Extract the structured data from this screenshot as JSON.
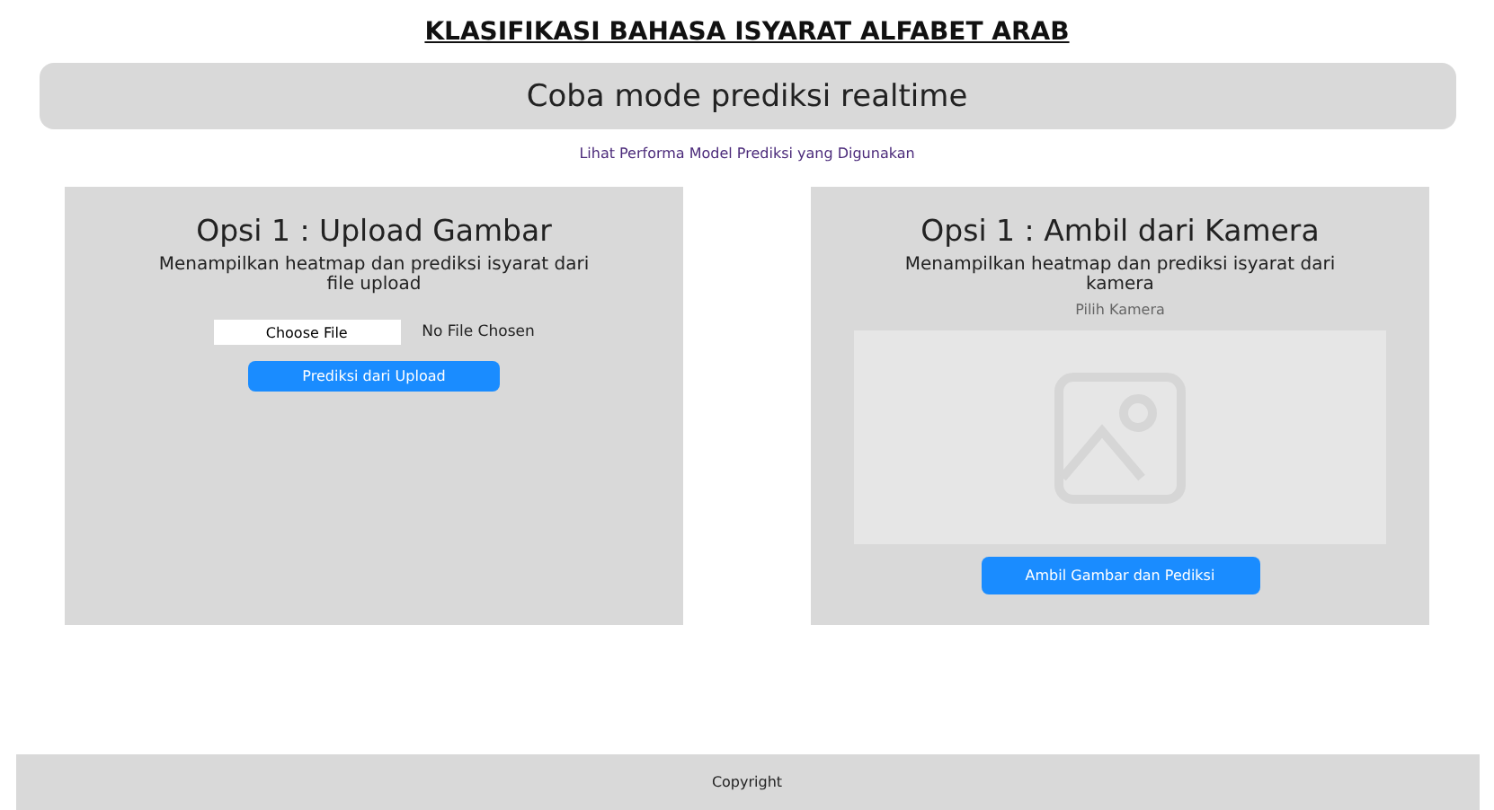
{
  "header": {
    "title": "KLASIFIKASI BAHASA ISYARAT ALFABET ARAB"
  },
  "banner": {
    "label": "Coba mode prediksi realtime"
  },
  "link": "Lihat Performa Model Prediksi yang Digunakan",
  "panels": [
    {
      "kind": "upload",
      "title": "Opsi 1 : Upload Gambar",
      "description": "Menampilkan heatmap dan prediksi isyarat dari file upload",
      "file_button": "Choose File",
      "file_status": "No File Chosen",
      "action": "Prediksi dari Upload"
    },
    {
      "kind": "camera",
      "title": "Opsi 1 : Ambil dari Kamera",
      "description": "Menampilkan heatmap dan prediksi isyarat dari kamera",
      "camera_label": "Pilih Kamera",
      "action": "Ambil Gambar dan Pediksi"
    }
  ],
  "footer": {
    "text": "Copyright"
  }
}
